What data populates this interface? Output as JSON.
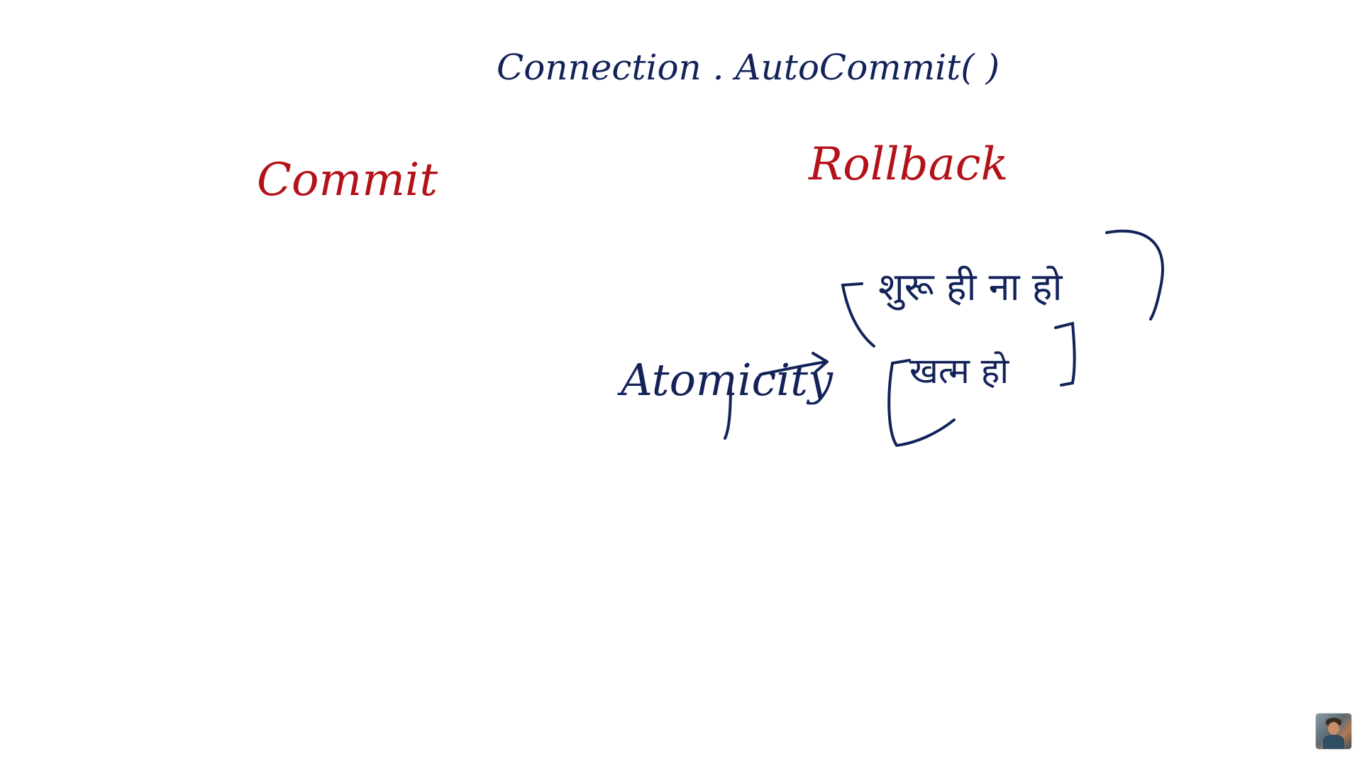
{
  "board": {
    "title": "Connection . AutoCommit( )",
    "left_heading": "Commit",
    "right_heading": "Rollback",
    "concept": "Atomicity",
    "note_1": "शुरू ही ना हो",
    "note_2": "खत्म हो"
  },
  "colors": {
    "navy_ink": "#13235a",
    "red_ink": "#b3121a",
    "background": "#ffffff"
  },
  "overlay": {
    "icon": "presenter-avatar-thumbnail"
  }
}
